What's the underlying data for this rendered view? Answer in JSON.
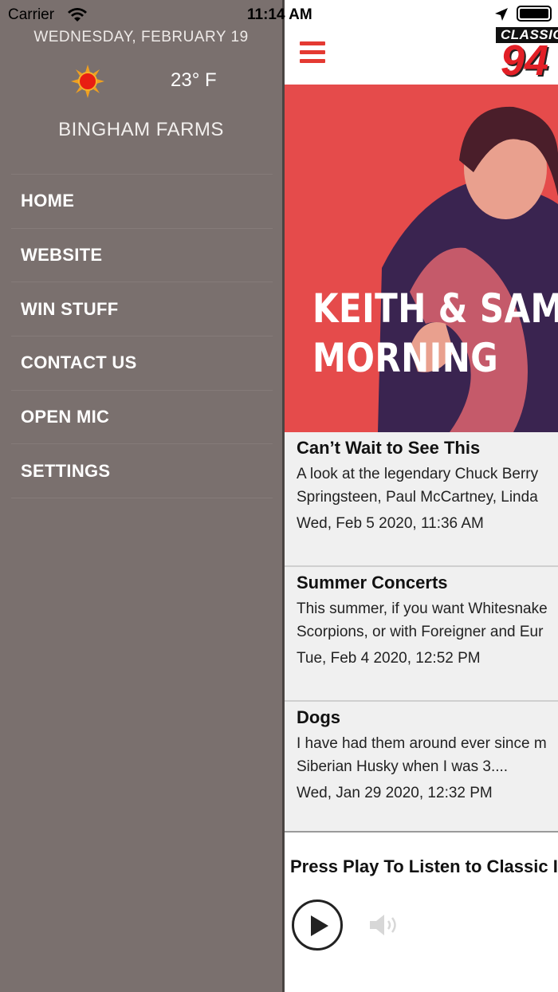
{
  "status_bar": {
    "carrier": "Carrier",
    "time": "11:14 AM"
  },
  "drawer": {
    "date": "WEDNESDAY, FEBRUARY 19",
    "weather_icon": "sun-icon",
    "temperature": "23° F",
    "city": "BINGHAM FARMS",
    "menu": [
      {
        "label": "HOME"
      },
      {
        "label": "WEBSITE"
      },
      {
        "label": "WIN STUFF"
      },
      {
        "label": "CONTACT US"
      },
      {
        "label": "OPEN MIC"
      },
      {
        "label": "SETTINGS"
      }
    ]
  },
  "header": {
    "menu_icon": "hamburger-icon",
    "logo_word": "CLASSIC",
    "logo_number": "94"
  },
  "hero": {
    "line1": "KEITH & SAM",
    "line2": "MORNING"
  },
  "feed": [
    {
      "title": "Can’t Wait to See This",
      "line1": "A look at the legendary Chuck Berry",
      "line2": "Springsteen, Paul McCartney, Linda",
      "date": "Wed, Feb 5 2020, 11:36 AM"
    },
    {
      "title": "Summer Concerts",
      "line1": "This summer, if you want Whitesnake",
      "line2": "Scorpions, or with Foreigner and Eur",
      "date": "Tue, Feb 4 2020, 12:52 PM"
    },
    {
      "title": "Dogs",
      "line1": "I have had them around ever since m",
      "line2": "Siberian Husky when I was 3....",
      "date": "Wed, Jan 29 2020, 12:32 PM"
    }
  ],
  "player": {
    "label": "Press Play To Listen to Classic I",
    "play_icon": "play-icon",
    "volume_icon": "volume-icon"
  },
  "colors": {
    "drawer_bg": "#7a706e",
    "accent_red": "#e43a32",
    "hero_bg": "#e54b4b",
    "feed_bg": "#f0f0f0"
  }
}
